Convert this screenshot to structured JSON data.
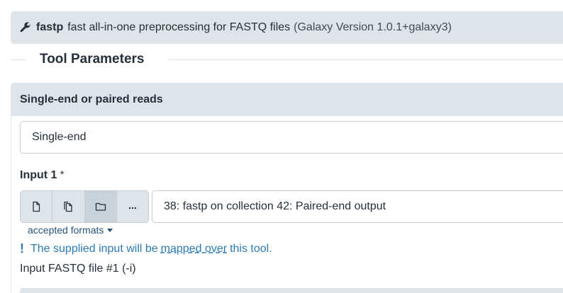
{
  "tool": {
    "name": "fastp",
    "description": "fast all-in-one preprocessing for FASTQ files",
    "version": "(Galaxy Version 1.0.1+galaxy3)"
  },
  "section": {
    "title": "Tool Parameters"
  },
  "reads_param": {
    "label": "Single-end or paired reads",
    "value": "Single-end"
  },
  "input1": {
    "label": "Input 1",
    "required_marker": "*",
    "buttons": [
      {
        "icon": "file-icon"
      },
      {
        "icon": "files-icon"
      },
      {
        "icon": "folder-icon"
      },
      {
        "icon": "more-icon"
      }
    ],
    "value": "38: fastp on collection 42: Paired-end output",
    "accepted_formats": "accepted formats",
    "mapped_notice": {
      "prefix": "The supplied input will be",
      "link": "mapped over",
      "suffix": "this tool."
    },
    "help": "Input FASTQ file #1 (-i)"
  },
  "colors": {
    "panel_bg": "#dfe4e9",
    "link": "#25537b",
    "info": "#2c7bb6"
  }
}
